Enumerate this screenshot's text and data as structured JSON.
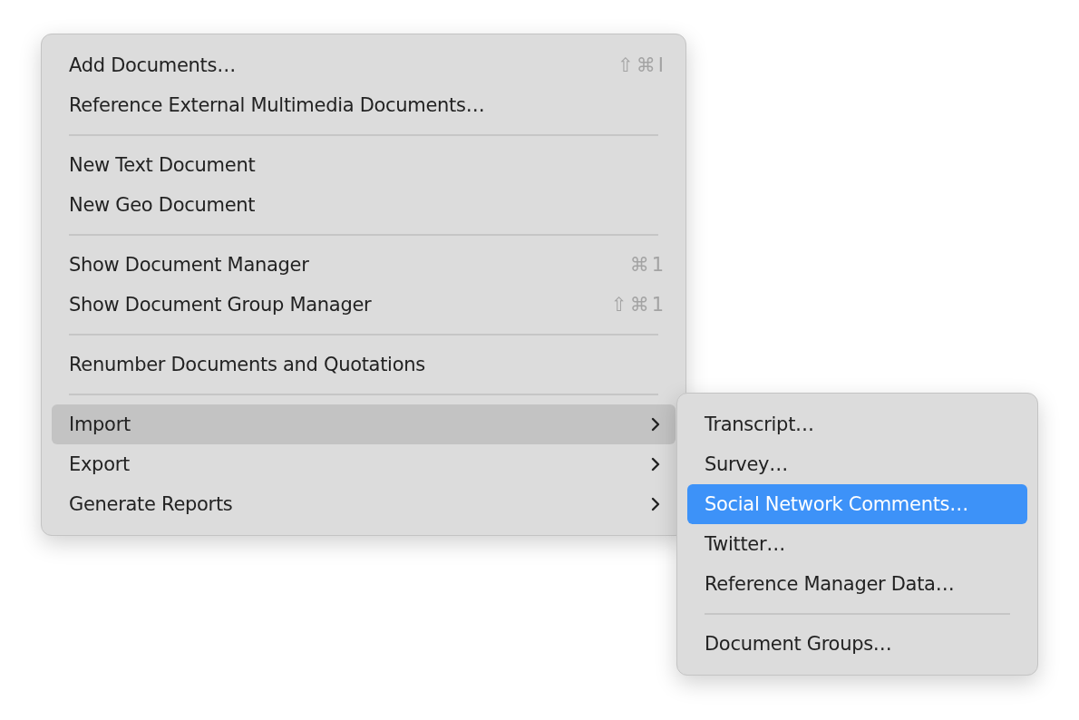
{
  "menu": {
    "items": [
      {
        "kind": "item",
        "label": "Add Documents…",
        "shortcut": "⇧⌘I",
        "submenu": false,
        "selected": false
      },
      {
        "kind": "item",
        "label": "Reference External Multimedia Documents…",
        "submenu": false,
        "selected": false
      },
      {
        "kind": "separator"
      },
      {
        "kind": "item",
        "label": "New Text Document",
        "submenu": false,
        "selected": false
      },
      {
        "kind": "item",
        "label": "New Geo Document",
        "submenu": false,
        "selected": false
      },
      {
        "kind": "separator"
      },
      {
        "kind": "item",
        "label": "Show Document Manager",
        "shortcut": "⌘1",
        "submenu": false,
        "selected": false
      },
      {
        "kind": "item",
        "label": "Show Document Group Manager",
        "shortcut": "⇧⌘1",
        "submenu": false,
        "selected": false
      },
      {
        "kind": "separator"
      },
      {
        "kind": "item",
        "label": "Renumber Documents and Quotations",
        "submenu": false,
        "selected": false
      },
      {
        "kind": "separator"
      },
      {
        "kind": "item",
        "label": "Import",
        "submenu": true,
        "selected": true
      },
      {
        "kind": "item",
        "label": "Export",
        "submenu": true,
        "selected": false
      },
      {
        "kind": "item",
        "label": "Generate Reports",
        "submenu": true,
        "selected": false
      }
    ]
  },
  "submenu": {
    "items": [
      {
        "kind": "item",
        "label": "Transcript…",
        "selected": false
      },
      {
        "kind": "item",
        "label": "Survey…",
        "selected": false
      },
      {
        "kind": "item",
        "label": "Social Network Comments…",
        "selected": true
      },
      {
        "kind": "item",
        "label": "Twitter…",
        "selected": false
      },
      {
        "kind": "item",
        "label": "Reference Manager Data…",
        "selected": false
      },
      {
        "kind": "separator"
      },
      {
        "kind": "item",
        "label": "Document Groups…",
        "selected": false
      }
    ]
  }
}
